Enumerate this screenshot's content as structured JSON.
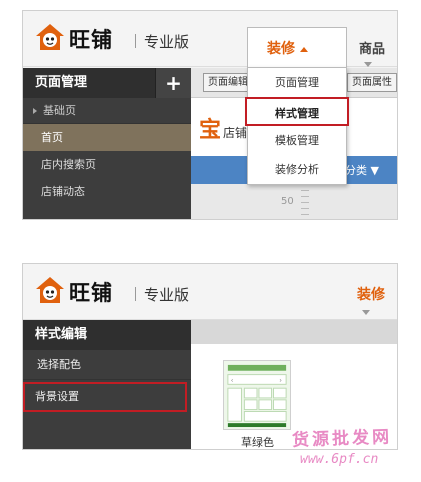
{
  "screens": [
    {
      "brand": "旺铺",
      "edition": "专业版",
      "nav": {
        "decorate": "装修",
        "goods": "商品"
      },
      "dropdown": [
        "页面管理",
        "样式管理",
        "模板管理",
        "装修分析"
      ],
      "dropdown_selected": "样式管理",
      "sidebar": {
        "title": "页面管理",
        "add": "+",
        "section": "基础页",
        "items": [
          "首页",
          "店内搜索页",
          "店铺动态"
        ],
        "active": "首页"
      },
      "toolbar": {
        "left": "页面编辑",
        "right": "页面属性"
      },
      "canvas": {
        "store": "店铺",
        "store_glyph": "宝",
        "category": "分类 ▼",
        "ruler": "50"
      }
    },
    {
      "brand": "旺铺",
      "edition": "专业版",
      "nav": {
        "decorate": "装修"
      },
      "sidebar": {
        "title": "样式编辑",
        "items": [
          "选择配色",
          "背景设置"
        ],
        "highlighted": "背景设置"
      },
      "theme": {
        "name": "草绿色"
      }
    }
  ],
  "watermark": {
    "text": "货源批发网",
    "url": "www.6pf.cn"
  },
  "colors": {
    "accent": "#e0610e",
    "highlight": "#c21d24",
    "sidebar": "#3d3d3d",
    "active": "#7f725c",
    "bar": "#4c84c4"
  }
}
